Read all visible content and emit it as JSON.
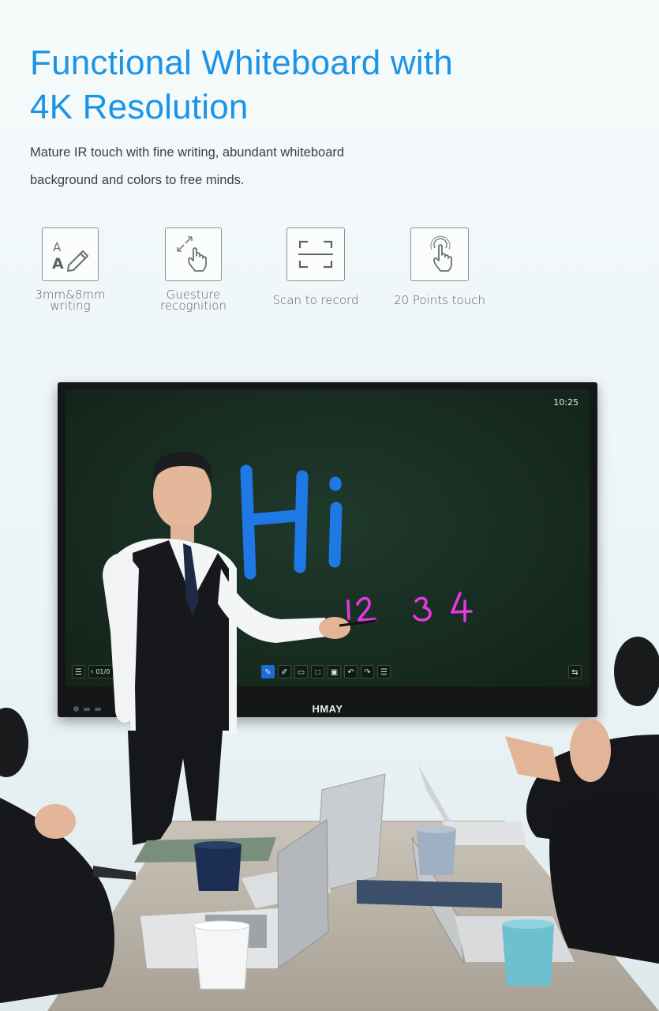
{
  "headline": {
    "line1": "Functional Whiteboard with",
    "line2": "4K Resolution"
  },
  "subtitle": {
    "line1": "Mature IR touch with fine writing, abundant whiteboard",
    "line2": "background and colors to free minds."
  },
  "features": [
    {
      "icon": "pen-writing-icon",
      "label_line1": "3mm&8mm",
      "label_line2": "writing"
    },
    {
      "icon": "gesture-hand-icon",
      "label_line1": "Guesture",
      "label_line2": "recognition"
    },
    {
      "icon": "scan-frame-icon",
      "label_line1": "Scan to record",
      "label_line2": ""
    },
    {
      "icon": "touch-finger-icon",
      "label_line1": "20 Points touch",
      "label_line2": ""
    }
  ],
  "board": {
    "clock": "10:25",
    "handwritten_text": "Hi",
    "handwritten_numbers": "1 2 3 4",
    "page_indicator": "01/0",
    "brand": "HMAY",
    "colors": {
      "heading": "#1c94e6",
      "ink_blue": "#1e78e6",
      "ink_magenta": "#e838e0",
      "screen": "#16291f"
    }
  }
}
